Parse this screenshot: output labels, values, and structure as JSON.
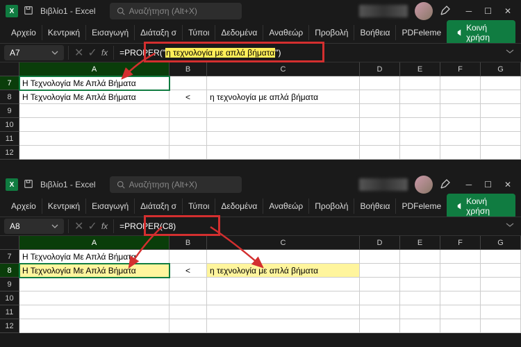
{
  "app": {
    "title": "Βιβλίο1 - Excel",
    "icon_letter": "X"
  },
  "search": {
    "placeholder": "Αναζήτηση (Alt+X)"
  },
  "ribbon": {
    "tabs": [
      "Αρχείο",
      "Κεντρική",
      "Εισαγωγή",
      "Διάταξη σ",
      "Τύποι",
      "Δεδομένα",
      "Αναθεώρ",
      "Προβολή",
      "Βοήθεια",
      "PDFeleme"
    ],
    "share": "Κοινή χρήση"
  },
  "top": {
    "namebox": "A7",
    "formula_prefix": "=PROPER(\"",
    "formula_hl": "η τεχνολογία με απλά βήματα",
    "formula_suffix": "\")",
    "rows": [
      {
        "n": "7",
        "a": "Η Τεχνολογία Με Απλά Βήματα",
        "b": "",
        "c": ""
      },
      {
        "n": "8",
        "a": "Η Τεχνολογία Με Απλά Βήματα",
        "b": "<",
        "c": "η τεχνολογία με απλά βήματα"
      },
      {
        "n": "9",
        "a": "",
        "b": "",
        "c": ""
      },
      {
        "n": "10",
        "a": "",
        "b": "",
        "c": ""
      },
      {
        "n": "11",
        "a": "",
        "b": "",
        "c": ""
      },
      {
        "n": "12",
        "a": "",
        "b": "",
        "c": ""
      }
    ]
  },
  "bottom": {
    "namebox": "A8",
    "formula": "=PROPER(C8)",
    "rows": [
      {
        "n": "7",
        "a": "Η Τεχνολογία Με Απλά Βήματα",
        "b": "",
        "c": ""
      },
      {
        "n": "8",
        "a": "Η Τεχνολογία Με Απλά Βήματα",
        "b": "<",
        "c": "η τεχνολογία με απλά βήματα"
      },
      {
        "n": "9",
        "a": "",
        "b": "",
        "c": ""
      },
      {
        "n": "10",
        "a": "",
        "b": "",
        "c": ""
      },
      {
        "n": "11",
        "a": "",
        "b": "",
        "c": ""
      },
      {
        "n": "12",
        "a": "",
        "b": "",
        "c": ""
      }
    ]
  },
  "cols": {
    "widths": [
      216,
      54,
      220,
      58,
      58,
      58,
      58
    ],
    "labels": [
      "A",
      "B",
      "C",
      "D",
      "E",
      "F",
      "G"
    ]
  }
}
